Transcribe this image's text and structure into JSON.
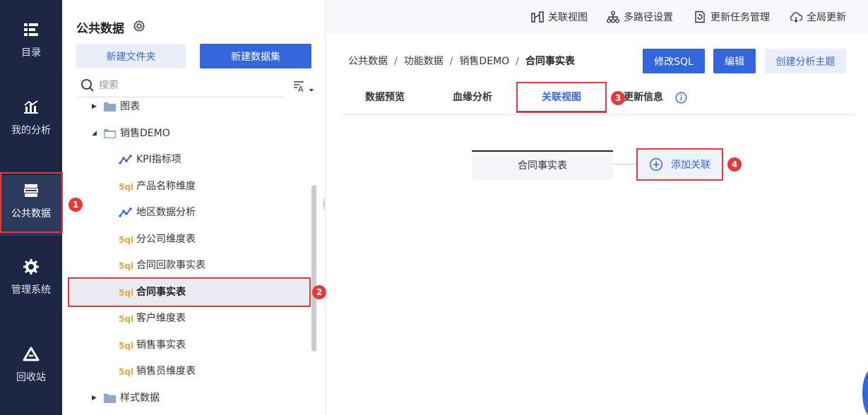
{
  "rail": {
    "items": [
      {
        "label": "目录",
        "icon": "list-icon"
      },
      {
        "label": "我的分析",
        "icon": "chart-analysis-icon"
      },
      {
        "label": "公共数据",
        "icon": "database-icon"
      },
      {
        "label": "管理系统",
        "icon": "gear-cog-icon"
      },
      {
        "label": "回收站",
        "icon": "recycle-icon"
      }
    ]
  },
  "tree_panel": {
    "title": "公共数据",
    "new_folder_label": "新建文件夹",
    "new_dataset_label": "新建数据集",
    "search_placeholder": "搜索",
    "nodes": [
      {
        "label": "图表",
        "type": "folder"
      },
      {
        "label": "销售DEMO",
        "type": "folder"
      },
      {
        "label": "KPI指标项",
        "type": "kpi"
      },
      {
        "label": "产品名称维度",
        "type": "sql"
      },
      {
        "label": "地区数据分析",
        "type": "kpi"
      },
      {
        "label": "分公司维度表",
        "type": "sql"
      },
      {
        "label": "合同回款事实表",
        "type": "sql"
      },
      {
        "label": "合同事实表",
        "type": "sql"
      },
      {
        "label": "客户维度表",
        "type": "sql"
      },
      {
        "label": "销售事实表",
        "type": "sql"
      },
      {
        "label": "销售员维度表",
        "type": "sql"
      },
      {
        "label": "样式数据",
        "type": "folder"
      }
    ]
  },
  "topbar": {
    "actions": [
      {
        "label": "关联视图",
        "icon": "relation-view-icon"
      },
      {
        "label": "多路径设置",
        "icon": "multi-path-icon"
      },
      {
        "label": "更新任务管理",
        "icon": "update-task-icon"
      },
      {
        "label": "全局更新",
        "icon": "cloud-update-icon"
      }
    ]
  },
  "main": {
    "breadcrumb": [
      "公共数据",
      "功能数据",
      "销售DEMO",
      "合同事实表"
    ],
    "breadcrumb_separator": "/",
    "buttons": {
      "edit_sql": "修改SQL",
      "edit": "编辑",
      "create_topic": "创建分析主题"
    },
    "tabs": [
      "数据预览",
      "血缘分析",
      "关联视图",
      "更新信息"
    ],
    "active_tab": "关联视图",
    "relation": {
      "table_label": "合同事实表",
      "add_label": "添加关联"
    }
  },
  "markers": [
    "1",
    "2",
    "3",
    "4"
  ],
  "colors": {
    "rail_bg": "#1c2743",
    "primary": "#3466db",
    "highlight": "#e03a3a",
    "sql_icon": "#f0a23a"
  }
}
